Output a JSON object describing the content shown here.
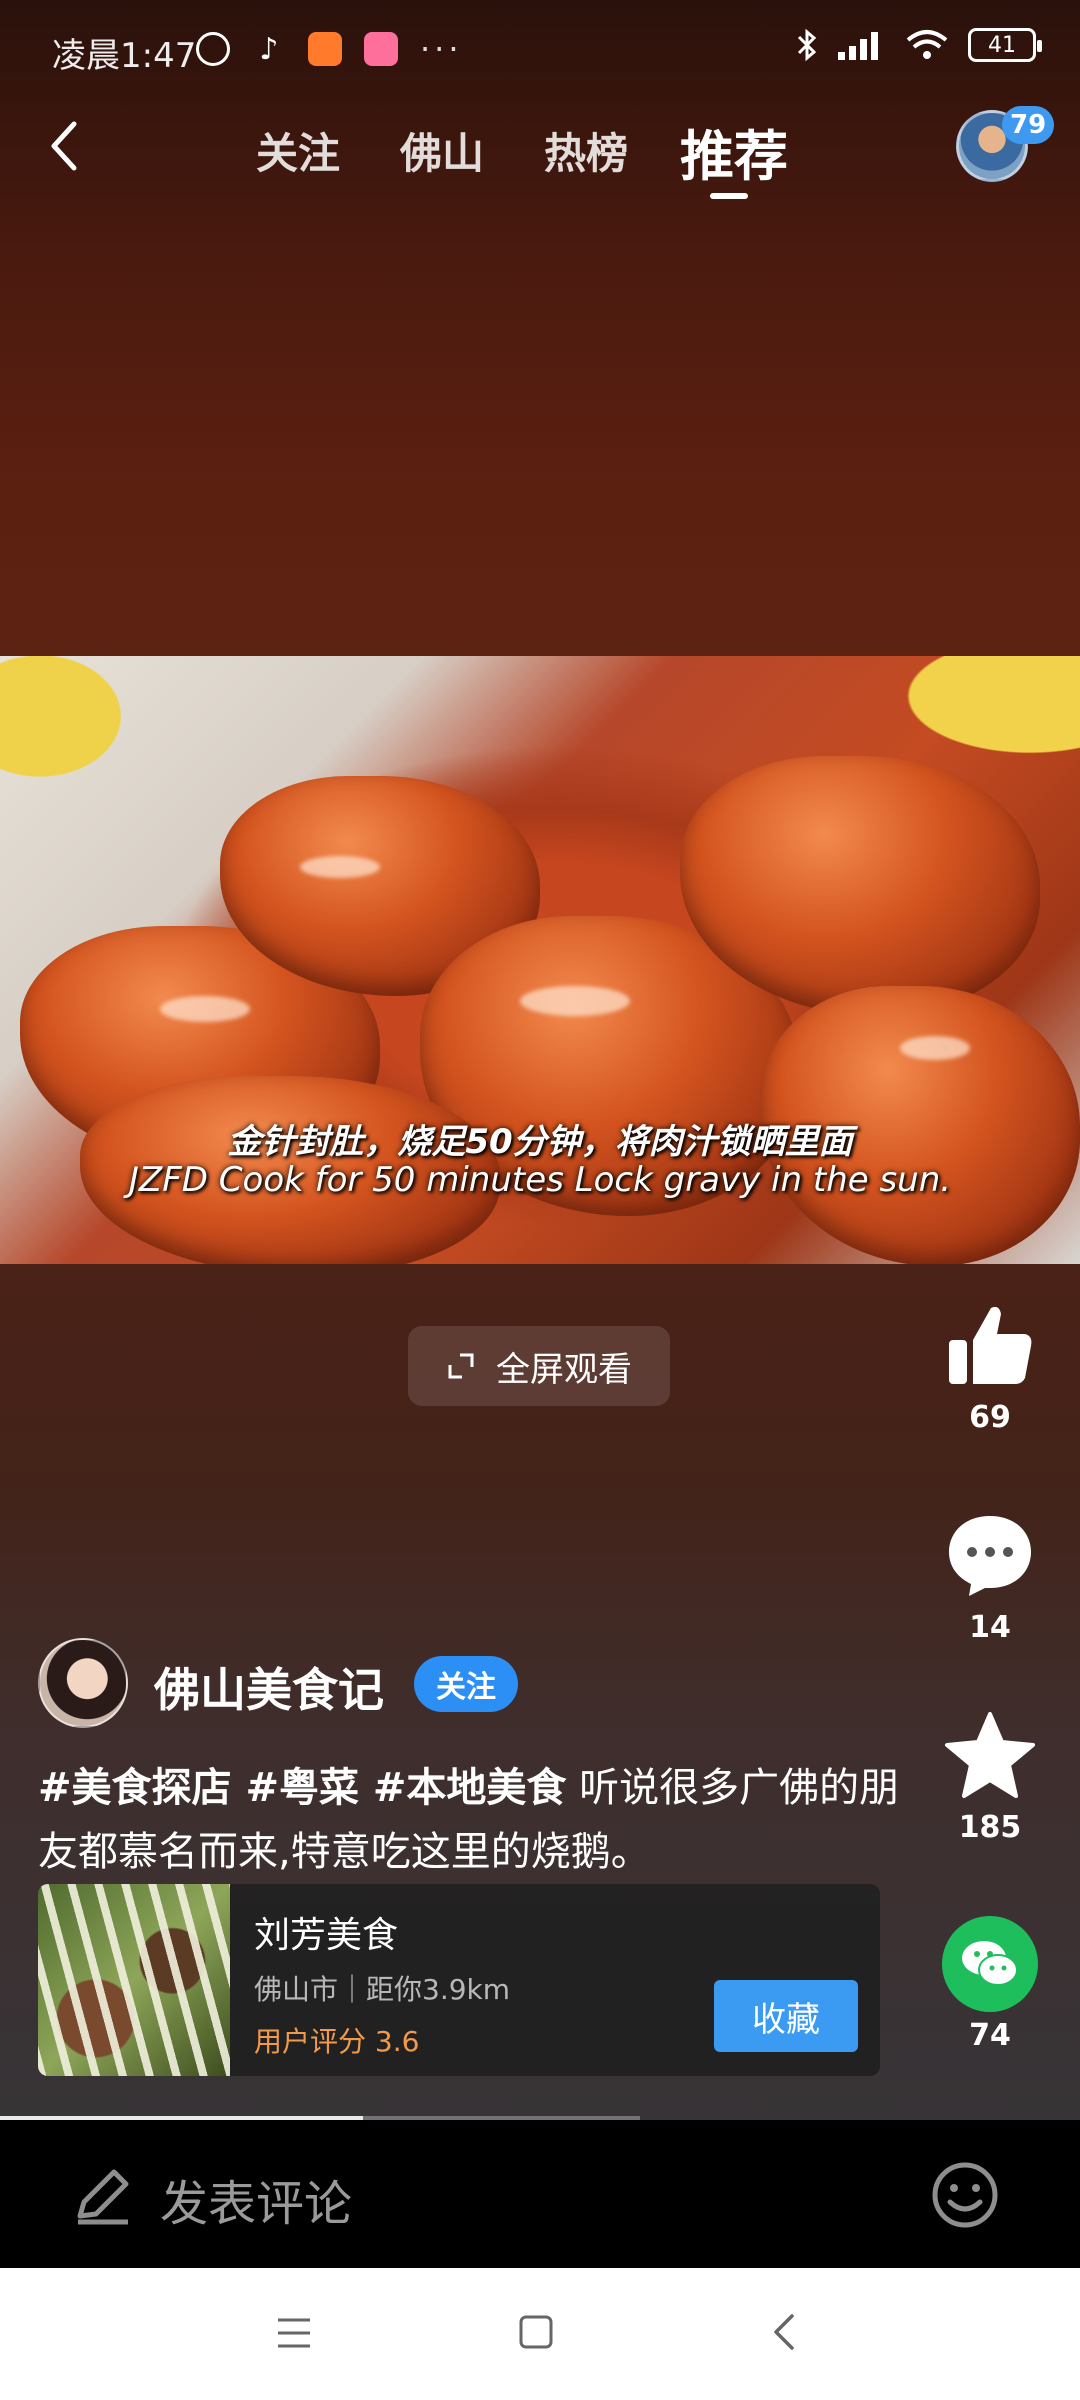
{
  "status_bar": {
    "time": "凌晨1:47",
    "battery": "41",
    "more": "···"
  },
  "top_nav": {
    "tabs": [
      "关注",
      "佛山",
      "热榜",
      "推荐"
    ],
    "active_tab": "推荐",
    "avatar_badge": "79"
  },
  "video": {
    "subtitle_cn": "金针封肚，烧足50分钟，将肉汁锁晒里面",
    "subtitle_en": "JZFD Cook for 50 minutes Lock  gravy in the sun.",
    "fullscreen_label": "全屏观看",
    "progress": 0.34
  },
  "actions": {
    "likes": "69",
    "comments": "14",
    "favorites": "185",
    "shares": "74"
  },
  "author": {
    "name": "佛山美食记",
    "follow_label": "关注"
  },
  "description": {
    "tags": "#美食探店 #粤菜 #本地美食",
    "text": " 听说很多广佛的朋友都慕名而来,特意吃这里的烧鹅。"
  },
  "poi": {
    "name": "刘芳美食",
    "location": "佛山市｜距你3.9km",
    "rating": "用户评分 3.6",
    "save_label": "收藏"
  },
  "comment_bar": {
    "placeholder": "发表评论"
  },
  "colors": {
    "accent_blue": "#2b8ff5",
    "wechat_green": "#1ebe5d",
    "rating_orange": "#f19a4a"
  }
}
